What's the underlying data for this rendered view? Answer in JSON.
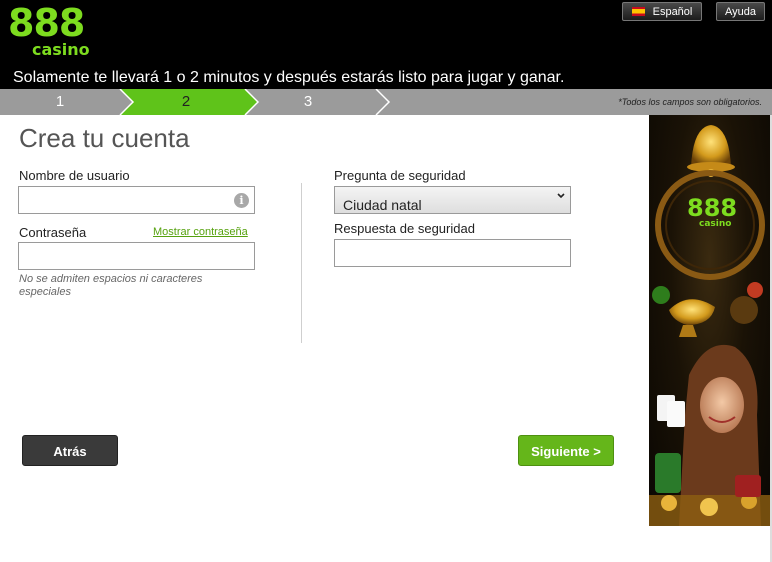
{
  "brand": {
    "logo_top": "888",
    "logo_bottom": "casino",
    "accent": "#7ddc1f"
  },
  "header": {
    "language_label": "Español",
    "help_label": "Ayuda",
    "tagline": "Solamente te llevará 1 o 2 minutos y después estarás listo para jugar y ganar."
  },
  "steps": {
    "items": [
      {
        "label": "1"
      },
      {
        "label": "2"
      },
      {
        "label": "3"
      }
    ],
    "active_index": 1,
    "required_note": "*Todos los campos son obligatorios."
  },
  "form": {
    "title": "Crea tu cuenta",
    "username_label": "Nombre de usuario",
    "username_value": "",
    "password_label": "Contraseña",
    "show_password": "Mostrar contraseña",
    "password_value": "",
    "password_hint": "No se admiten espacios ni caracteres especiales",
    "security_question_label": "Pregunta de seguridad",
    "security_question_value": "Ciudad natal",
    "security_answer_label": "Respuesta de seguridad",
    "security_answer_value": ""
  },
  "buttons": {
    "back": "Atrás",
    "next": "Siguiente >"
  },
  "ad": {
    "brand_top": "888",
    "brand_bottom": "casino"
  },
  "colors": {
    "primary_green": "#65b61a",
    "step_active": "#5fc31a",
    "step_bar": "#9b9b9b",
    "dark_button": "#3a3a3a"
  }
}
